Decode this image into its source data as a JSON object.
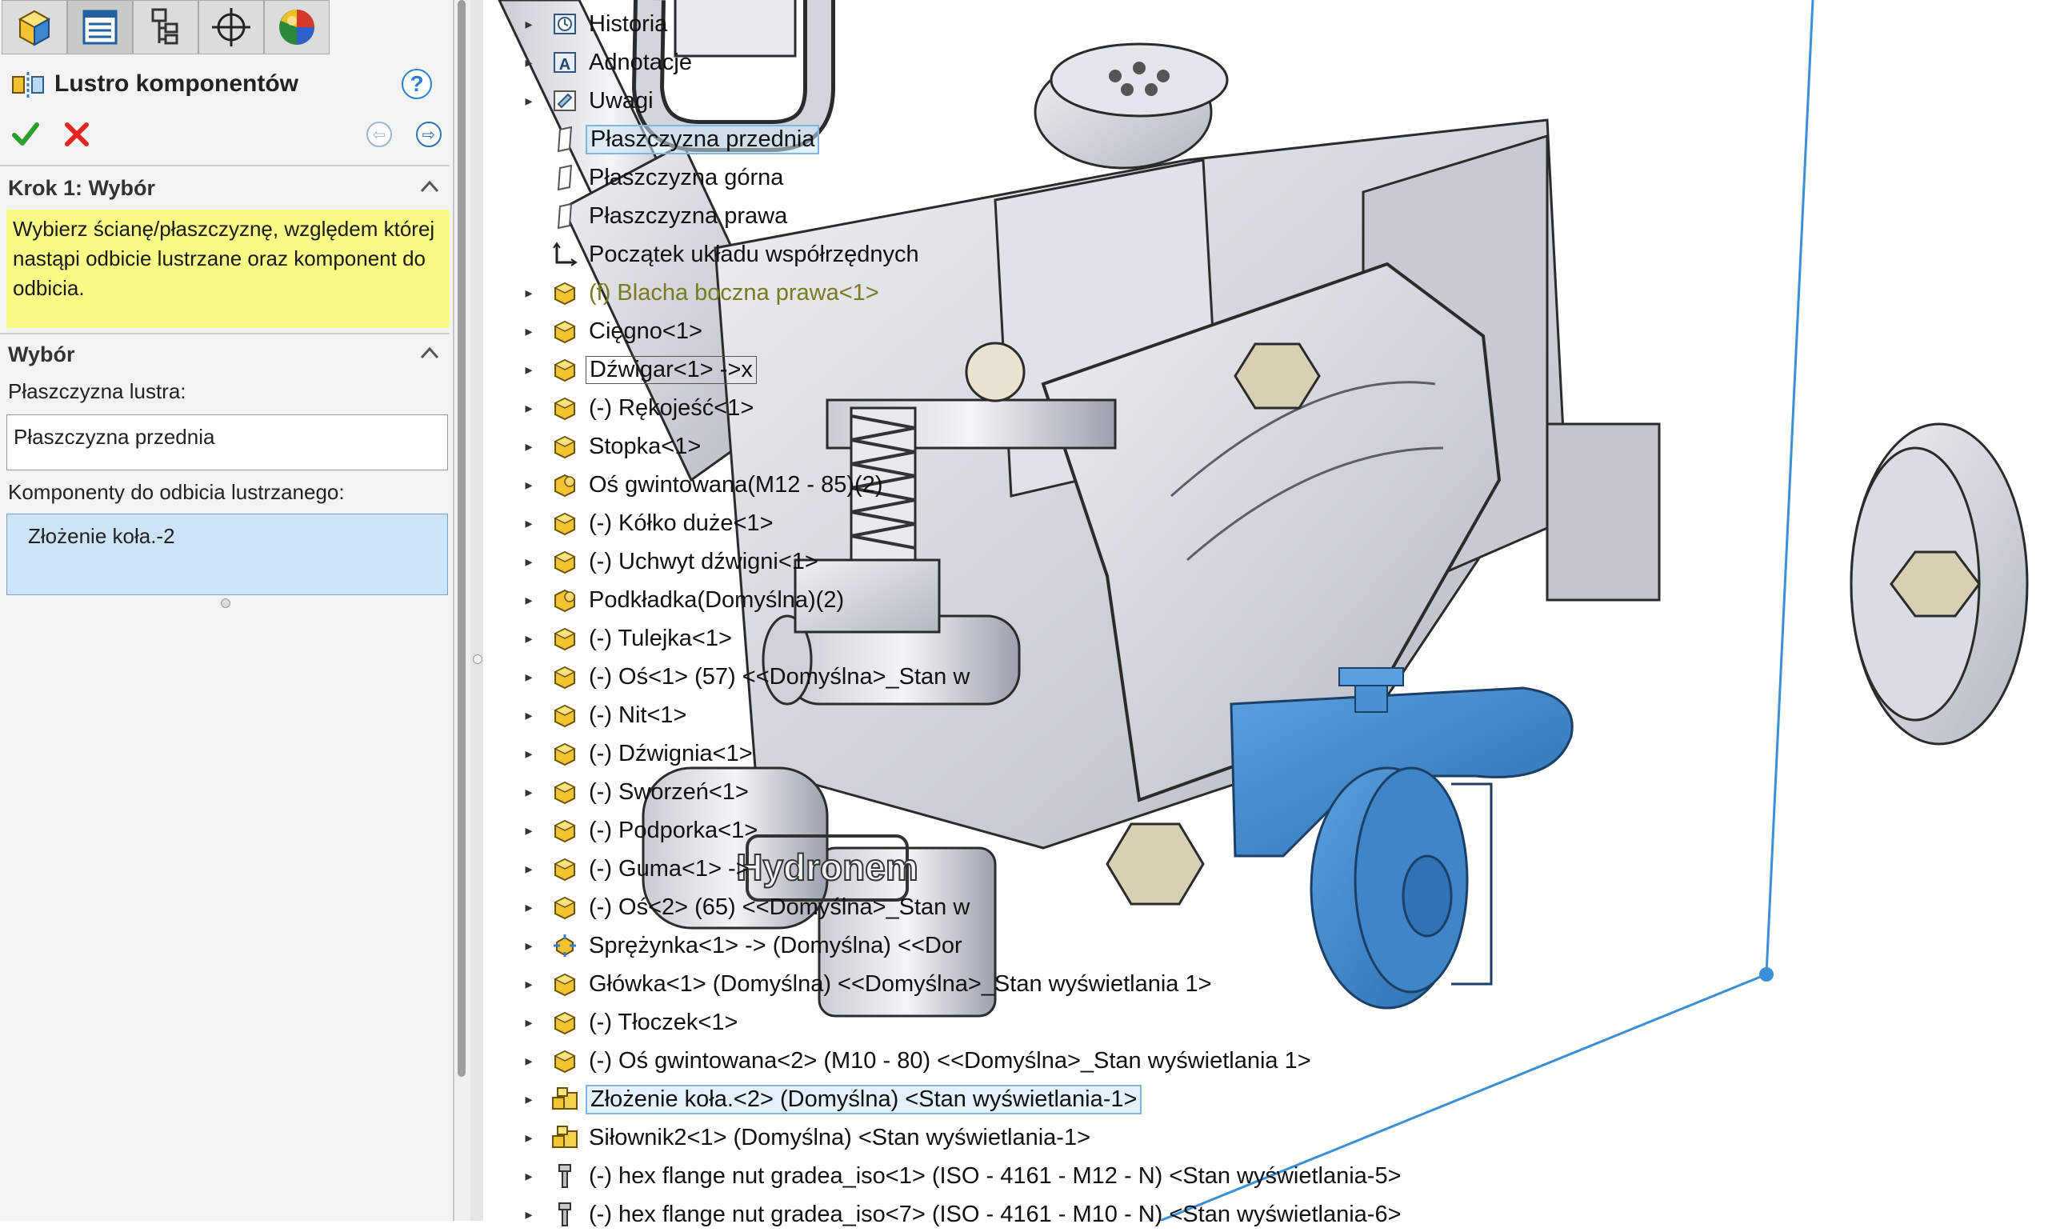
{
  "property_manager": {
    "tabs": [
      {
        "icon": "featuremanager-icon"
      },
      {
        "icon": "propertymanager-icon"
      },
      {
        "icon": "configurationmanager-icon"
      },
      {
        "icon": "dimxpertmanager-icon"
      },
      {
        "icon": "displaymanager-icon"
      }
    ],
    "title": "Lustro komponentów",
    "help_label": "?",
    "step_group": {
      "title": "Krok 1: Wybór",
      "message": "Wybierz ścianę/płaszczyznę, względem której nastąpi odbicie lustrzane oraz komponent do odbicia."
    },
    "selection_group": {
      "title": "Wybór",
      "mirror_plane_label": "Płaszczyzna lustra:",
      "mirror_plane_value": "Płaszczyzna przednia",
      "components_label": "Komponenty do odbicia lustrzanego:",
      "components": [
        "Złożenie koła.-2"
      ]
    }
  },
  "tree": {
    "items": [
      {
        "label": "Historia",
        "icon": "history-icon"
      },
      {
        "label": "Adnotacje",
        "icon": "annotations-icon"
      },
      {
        "label": "Uwagi",
        "icon": "notes-icon"
      },
      {
        "label": "Płaszczyzna przednia",
        "icon": "plane-icon",
        "state": "selected"
      },
      {
        "label": "Płaszczyzna górna",
        "icon": "plane-icon"
      },
      {
        "label": "Płaszczyzna prawa",
        "icon": "plane-icon"
      },
      {
        "label": "Początek układu współrzędnych",
        "icon": "origin-icon"
      },
      {
        "label": "(f) Blacha boczna prawa<1>",
        "icon": "part-icon",
        "state": "olive"
      },
      {
        "label": "Cięgno<1>",
        "icon": "part-icon"
      },
      {
        "label": "Dźwigar<1> ->x",
        "icon": "part-icon",
        "state": "boxed"
      },
      {
        "label": "(-) Rękojeść<1>",
        "icon": "part-icon"
      },
      {
        "label": "Stopka<1>",
        "icon": "part-icon"
      },
      {
        "label": "Oś gwintowana(M12 - 85)(2)",
        "icon": "toolbox-part-icon"
      },
      {
        "label": "(-) Kółko duże<1>",
        "icon": "part-icon"
      },
      {
        "label": "(-) Uchwyt dźwigni<1>",
        "icon": "part-icon"
      },
      {
        "label": "Podkładka(Domyślna)(2)",
        "icon": "toolbox-part-icon"
      },
      {
        "label": "(-) Tulejka<1>",
        "icon": "part-icon"
      },
      {
        "label": "(-) Oś<1> (57) <<Domyślna>_Stan w",
        "icon": "part-icon"
      },
      {
        "label": "(-) Nit<1>",
        "icon": "part-icon"
      },
      {
        "label": "(-) Dźwignia<1>",
        "icon": "part-icon"
      },
      {
        "label": "(-) Sworzeń<1>",
        "icon": "part-icon"
      },
      {
        "label": "(-) Podporka<1>",
        "icon": "part-icon"
      },
      {
        "label": "(-) Guma<1> ->",
        "icon": "part-icon"
      },
      {
        "label": "(-) Oś<2> (65) <<Domyślna>_Stan w",
        "icon": "part-icon"
      },
      {
        "label": "Sprężynka<1> -> (Domyślna) <<Dor",
        "icon": "spring-part-icon"
      },
      {
        "label": "Główka<1> (Domyślna) <<Domyślna>_Stan wyświetlania 1>",
        "icon": "part-icon"
      },
      {
        "label": "(-) Tłoczek<1>",
        "icon": "part-icon"
      },
      {
        "label": "(-) Oś gwintowana<2> (M10 - 80) <<Domyślna>_Stan wyświetlania 1>",
        "icon": "part-icon"
      },
      {
        "label": "Złożenie koła.<2> (Domyślna) <Stan wyświetlania-1>",
        "icon": "subassembly-icon",
        "state": "selected"
      },
      {
        "label": "Siłownik2<1> (Domyślna) <Stan wyświetlania-1>",
        "icon": "subassembly-icon"
      },
      {
        "label": "(-) hex flange nut gradea_iso<1> (ISO - 4161 - M12 - N) <Stan wyświetlania-5>",
        "icon": "bolt-icon"
      },
      {
        "label": "(-) hex flange nut gradea_iso<7> (ISO - 4161 - M10 - N) <Stan wyświetlania-6>",
        "icon": "bolt-icon"
      }
    ]
  },
  "viewport": {
    "model_engraving": "Hydronem",
    "colors": {
      "metal": "#d6d9e0",
      "metal_dark": "#9ea3ae",
      "edge": "#2b2b2b",
      "highlight": "#3c86c8",
      "plane": "#3b8fd6",
      "message_bg": "#fafa87"
    }
  }
}
